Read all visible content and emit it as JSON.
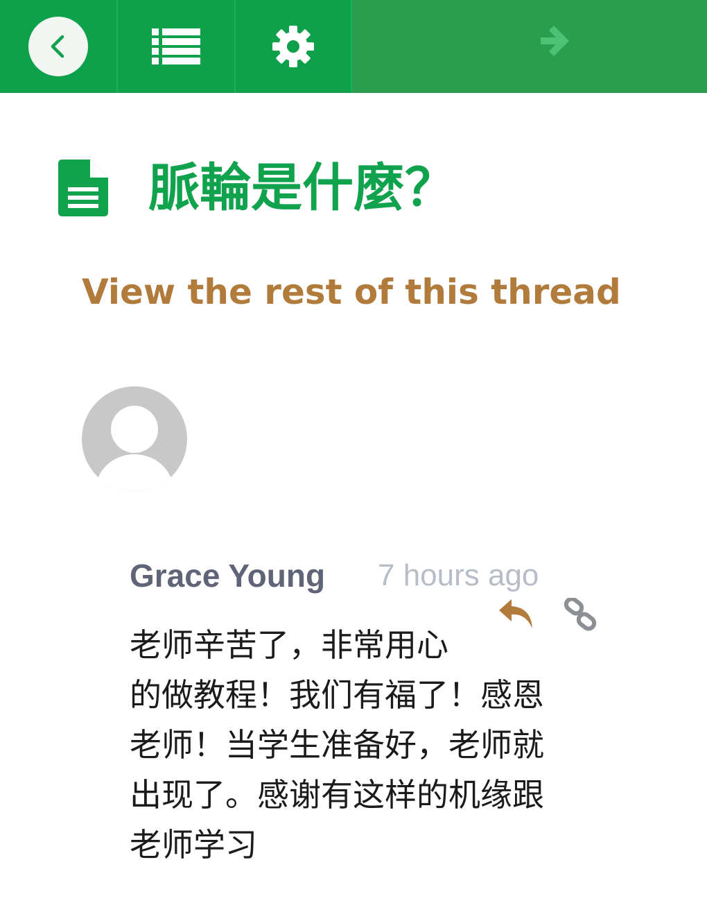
{
  "topbar": {
    "back_icon": "chevron-left-icon",
    "list_icon": "list-icon",
    "settings_icon": "gear-icon",
    "next_icon": "arrow-right-icon",
    "colors": {
      "primary": "#0fa04b",
      "bar_right": "#2a9d4e",
      "next_arrow": "#4cc274"
    }
  },
  "page": {
    "doc_icon": "document-icon",
    "title": "脈輪是什麼？",
    "thread_link": "View the rest of this thread",
    "colors": {
      "title": "#11a24e",
      "thread_link": "#b17b3c"
    }
  },
  "comment": {
    "avatar_icon": "default-user-avatar",
    "author": "Grace Young",
    "timestamp": "7 hours ago",
    "reply_icon": "reply-icon",
    "link_icon": "link-icon",
    "body_lines": [
      "老师辛苦了，非常用心",
      "的做教程！我们有福了！感恩",
      "老师！当学生准备好，老师就",
      "出现了。感谢有这样的机缘跟",
      "老师学习"
    ]
  }
}
